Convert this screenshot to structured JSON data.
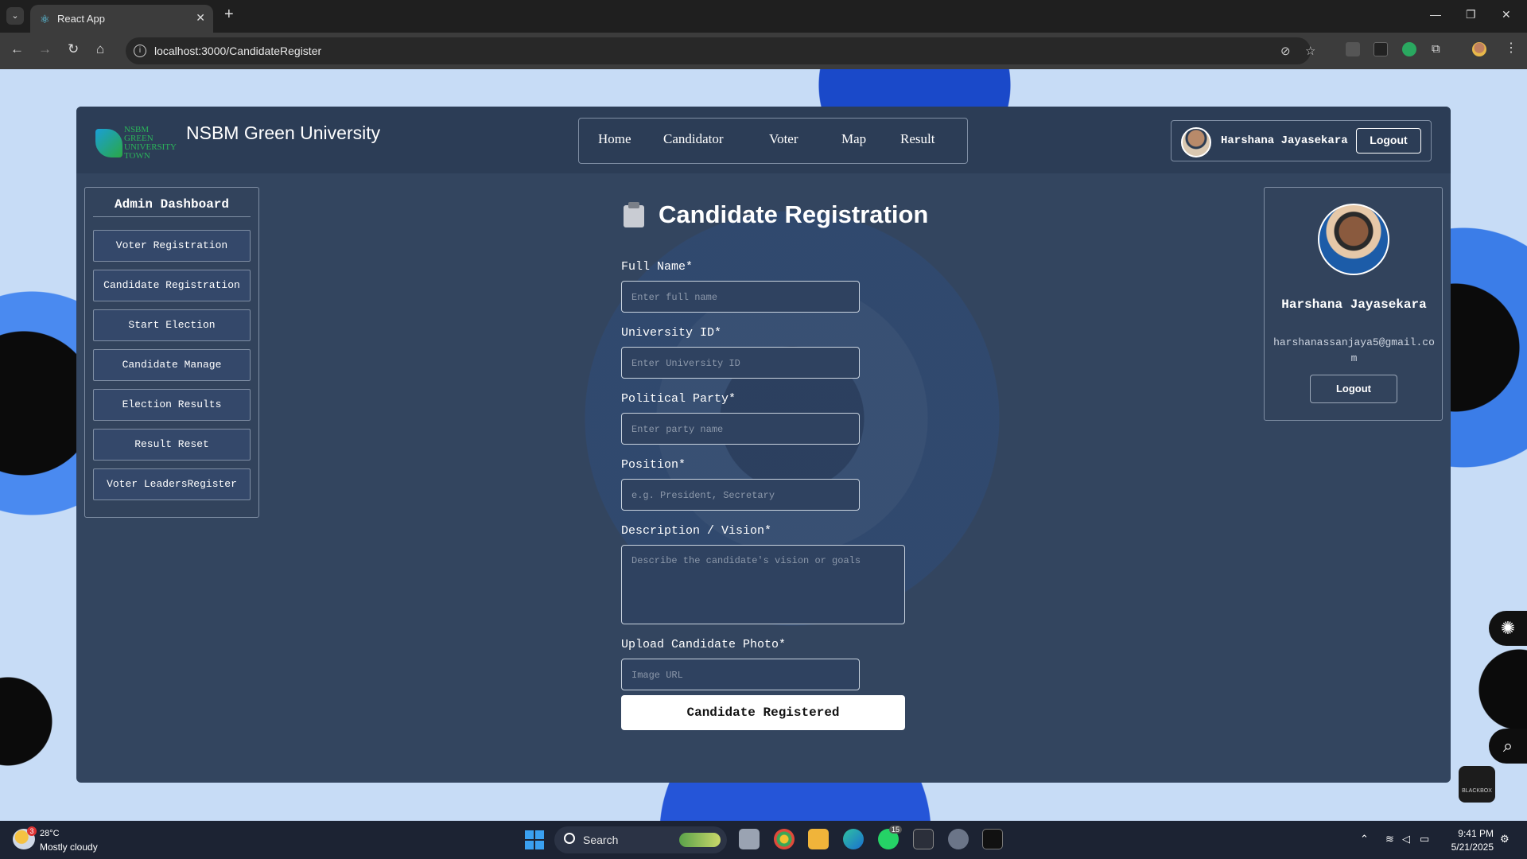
{
  "browser": {
    "tab_title": "React App",
    "url": "localhost:3000/CandidateRegister"
  },
  "header": {
    "logo_text": "NSBM GREEN UNIVERSITY TOWN",
    "brand": "NSBM Green University",
    "nav": [
      "Home",
      "Candidator",
      "Voter",
      "Map",
      "Result"
    ],
    "user_name": "Harshana Jayasekara",
    "logout_label": "Logout"
  },
  "sidebar": {
    "title": "Admin Dashboard",
    "items": [
      "Voter Registration",
      "Candidate Registration",
      "Start Election",
      "Candidate Manage",
      "Election Results",
      "Result Reset",
      "Voter LeadersRegister"
    ]
  },
  "form": {
    "title": "Candidate Registration",
    "fields": [
      {
        "label": "Full Name*",
        "placeholder": "Enter full name"
      },
      {
        "label": "University ID*",
        "placeholder": "Enter University ID"
      },
      {
        "label": "Political Party*",
        "placeholder": "Enter party name"
      },
      {
        "label": "Position*",
        "placeholder": "e.g. President, Secretary"
      },
      {
        "label": "Description / Vision*",
        "placeholder": "Describe the candidate's vision or goals"
      },
      {
        "label": "Upload Candidate Photo*",
        "placeholder": "Image URL"
      }
    ],
    "submit_label": "Candidate Registered"
  },
  "profile": {
    "name": "Harshana Jayasekara",
    "email": "harshanassanjaya5@gmail.com",
    "logout_label": "Logout"
  },
  "taskbar": {
    "weather_temp": "28°C",
    "weather_desc": "Mostly cloudy",
    "weather_badge": "3",
    "search_label": "Search",
    "time": "9:41 PM",
    "date": "5/21/2025",
    "whatsapp_badge": "15"
  },
  "floating": {
    "blackbox_label": "BLACKBOX"
  },
  "colors": {
    "app_bg": "#33455f",
    "header_bg": "#2c3d56",
    "page_bg": "#c7dcf6",
    "submit_bg": "#ffffff"
  }
}
